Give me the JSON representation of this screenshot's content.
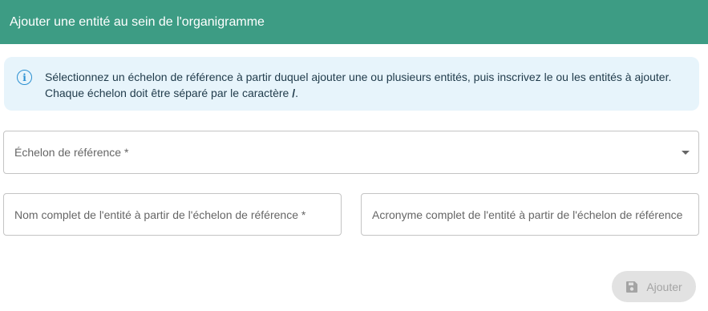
{
  "header": {
    "title": "Ajouter une entité au sein de l'organigramme"
  },
  "info": {
    "icon": "info-icon",
    "text_before": "Sélectionnez un échelon de référence à partir duquel ajouter une ou plusieurs entités, puis inscrivez le ou les entités à ajouter. Chaque échelon doit être séparé par le caractère ",
    "separator": "/",
    "text_after": ".",
    "accent_color": "#2a8fd1"
  },
  "fields": {
    "reference_level": {
      "label": "Échelon de référence *",
      "icon": "chevron-down-icon"
    },
    "full_name": {
      "label": "Nom complet de l'entité à partir de l'échelon de référence *"
    },
    "acronym": {
      "label": "Acronyme complet de l'entité à partir de l'échelon de référence"
    }
  },
  "actions": {
    "add_label": "Ajouter",
    "add_icon": "save-icon"
  },
  "colors": {
    "header": "#3d9c84",
    "info_bg": "#e7f4fb",
    "button_disabled": "#e2e2e2"
  }
}
